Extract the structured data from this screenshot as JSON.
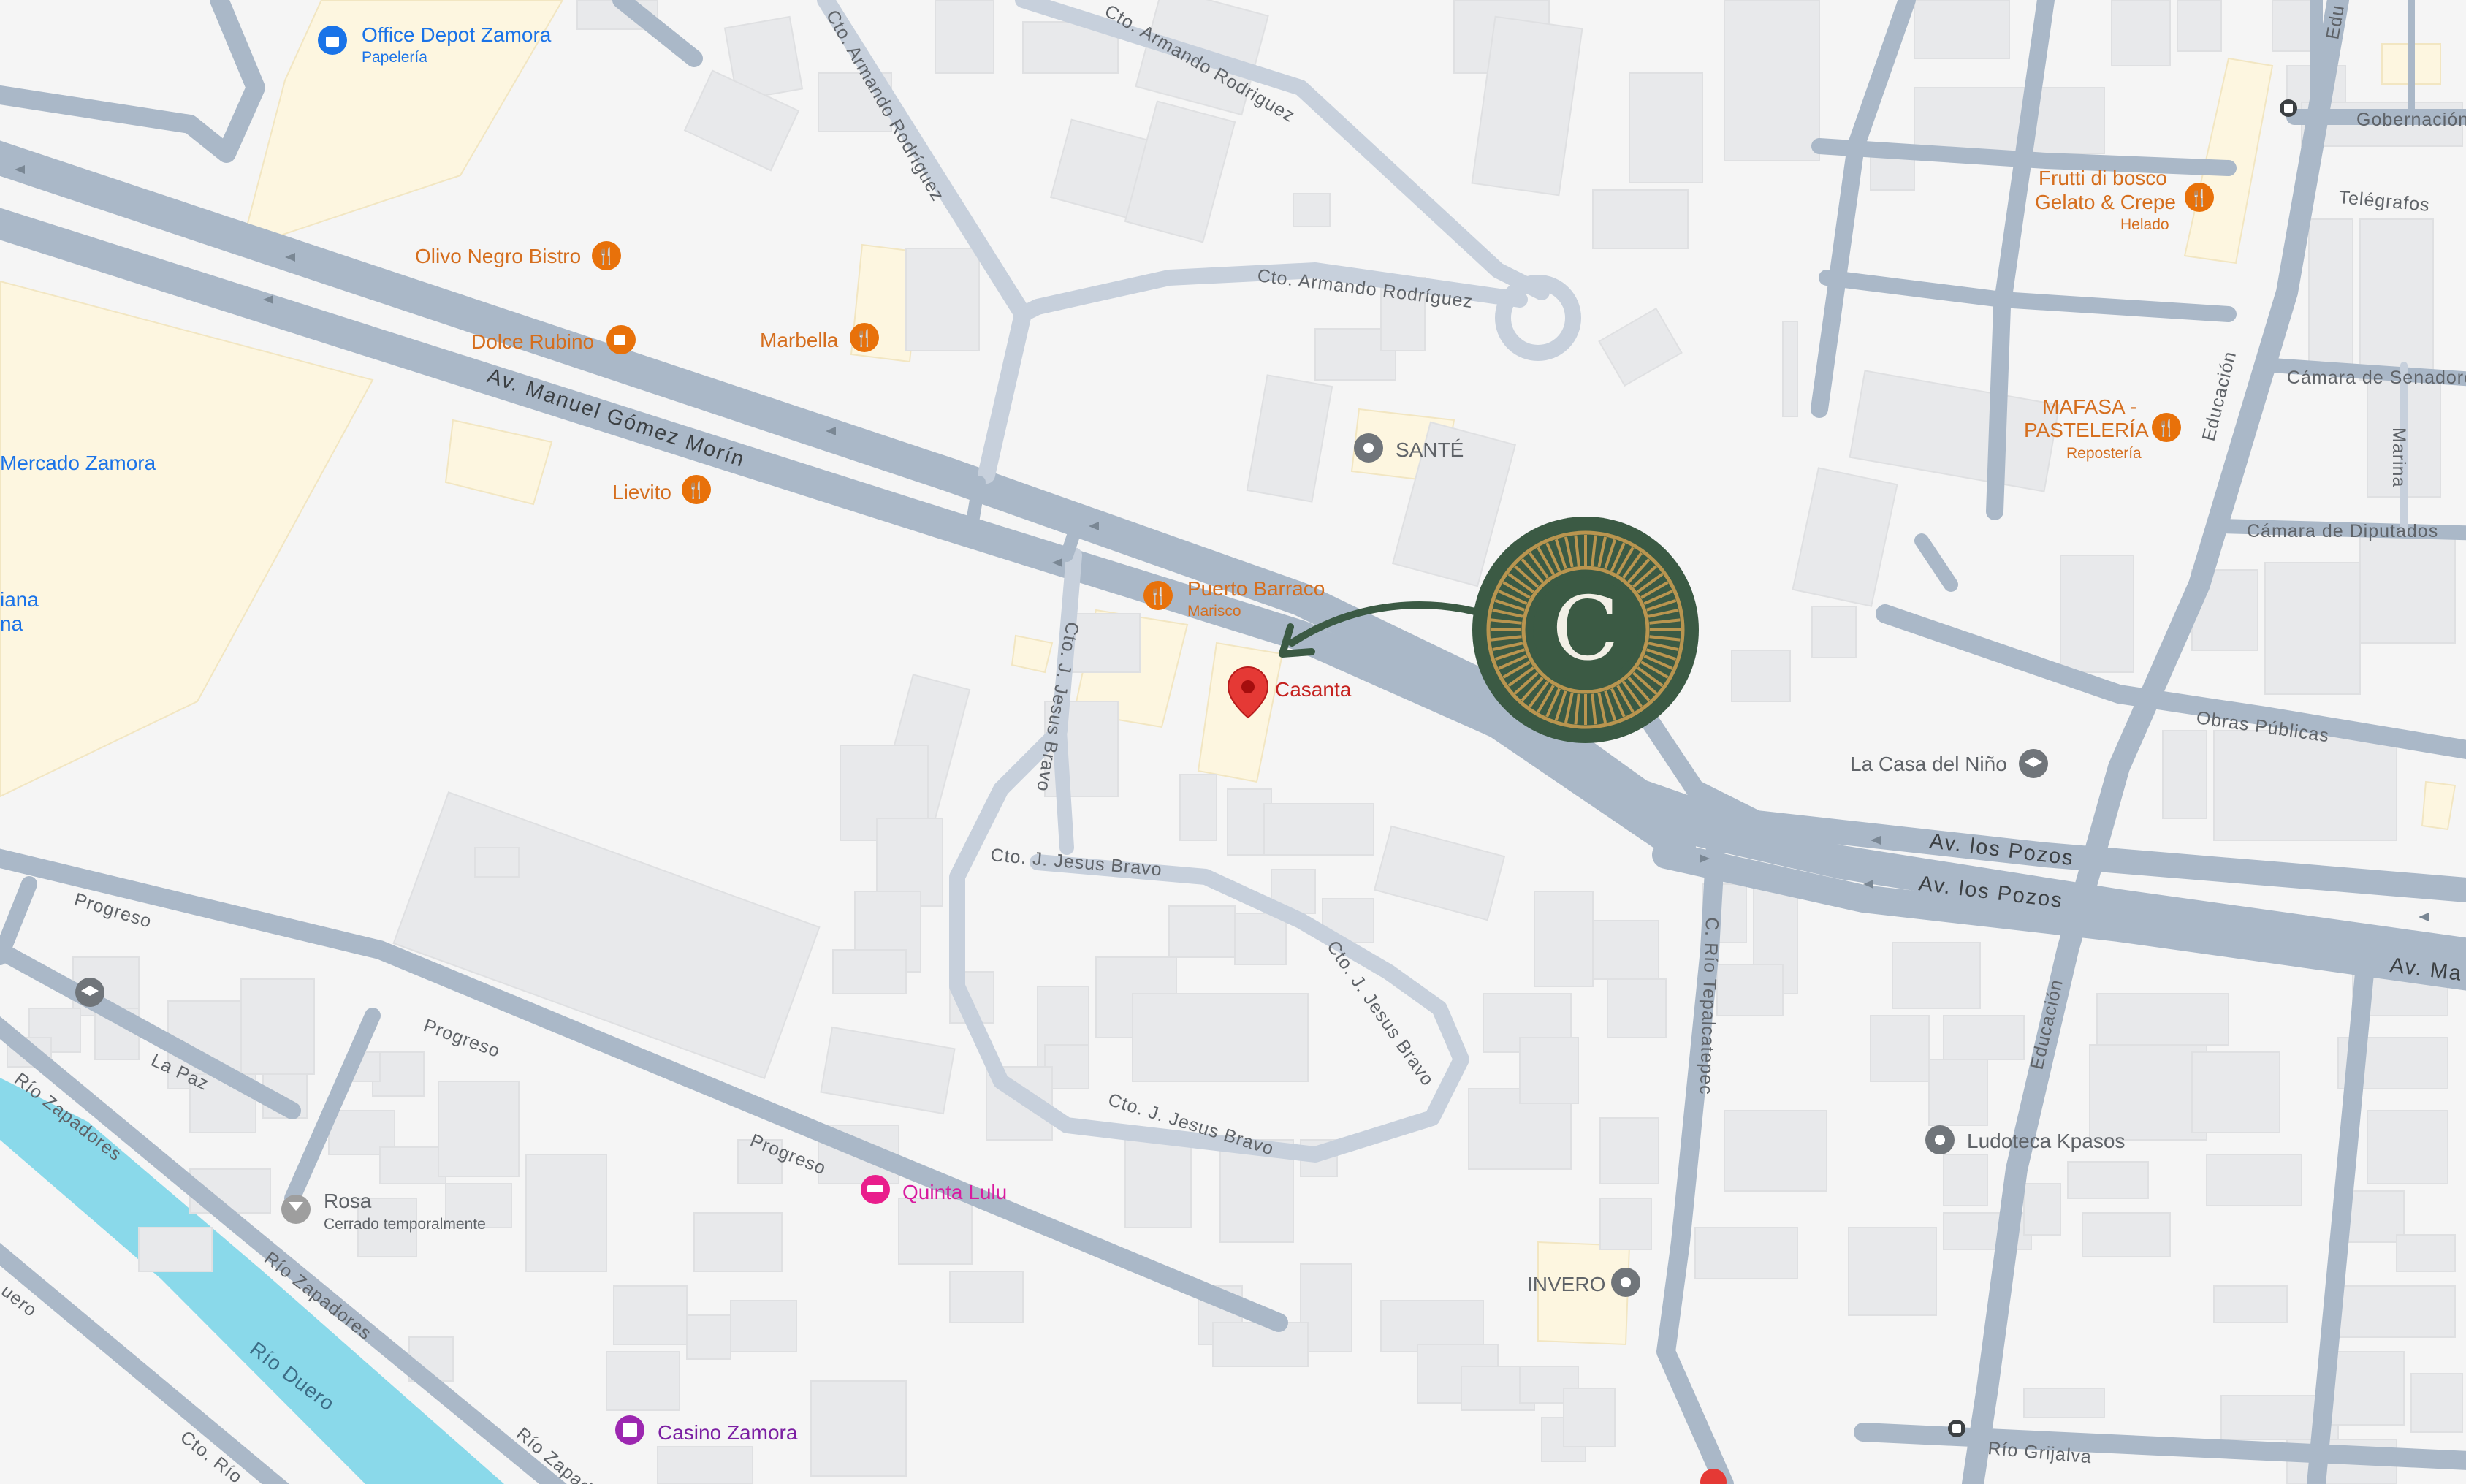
{
  "map": {
    "roads": {
      "av_manuel_gomez_morin": "Av. Manuel Gómez Morín",
      "av_los_pozos_1": "Av. los Pozos",
      "av_los_pozos_2": "Av. los Pozos",
      "av_ma_partial": "Av. Ma",
      "cto_armando_rodriguez_1": "Cto. Armando Rodríguez",
      "cto_armando_rodriguez_2": "Cto. Armando Rodríguez",
      "cto_armando_rodriguez_3": "Cto. Armando Rodriguez",
      "cto_j_jesus_bravo_1": "Cto. J. Jesus Bravo",
      "cto_j_jesus_bravo_2": "Cto. J. Jesus Bravo",
      "cto_j_jesus_bravo_3": "Cto. J. Jesus Bravo",
      "cto_j_jesus_bravo_4": "Cto. J. Jesus Bravo",
      "progreso_1": "Progreso",
      "progreso_2": "Progreso",
      "progreso_3": "Progreso",
      "la_paz": "La Paz",
      "rio_zapadores_1": "Río Zapadores",
      "rio_zapadores_2": "Río Zapadores",
      "rio_zapadores_3": "Río Zapadores",
      "c_rio_tepalcatepec": "C. Río Tepalcatepec",
      "educacion_1": "Educación",
      "educacion_2": "Educación",
      "educacion_3": "Edu",
      "obras_publicas": "Obras Públicas",
      "camara_de_senadores": "Cámara de Senadores",
      "camara_de_diputados": "Cámara de Diputados",
      "marina": "Marina",
      "telegrafos": "Telégrafos",
      "gobernacion": "Gobernación",
      "rio_grijalva": "Río Grijalva",
      "cto_rio": "Cto. Río",
      "uero": "uero"
    },
    "river": {
      "name": "Río Duero",
      "color": "#8ad9ea"
    },
    "pois": {
      "office_depot": {
        "name": "Office Depot Zamora",
        "sub": "Papelería",
        "icon": "shopping-bag-icon"
      },
      "olivo_negro": {
        "name": "Olivo Negro Bistro",
        "icon": "restaurant-icon"
      },
      "dolce_rubino": {
        "name": "Dolce Rubino",
        "icon": "cafe-icon"
      },
      "marbella": {
        "name": "Marbella",
        "icon": "restaurant-icon"
      },
      "mercado_zamora": {
        "name": "Mercado Zamora"
      },
      "iana": {
        "name": "iana"
      },
      "na": {
        "name": "na"
      },
      "lievito": {
        "name": "Lievito",
        "icon": "restaurant-icon"
      },
      "puerto_barraco": {
        "name": "Puerto Barraco",
        "sub": "Marisco",
        "icon": "restaurant-icon"
      },
      "casanta": {
        "name": "Casanta",
        "icon": "location-pin-icon"
      },
      "sante": {
        "name": "SANTÉ",
        "icon": "place-icon"
      },
      "frutti_di_bosco": {
        "name": "Frutti di bosco",
        "name2": "Gelato & Crepe",
        "sub": "Helado",
        "icon": "restaurant-icon"
      },
      "mafasa": {
        "name": "MAFASA -",
        "name2": "PASTELERÍA",
        "sub": "Repostería",
        "icon": "restaurant-icon"
      },
      "la_casa_del_nino": {
        "name": "La Casa del Niño",
        "icon": "school-icon"
      },
      "ludoteca": {
        "name": "Ludoteca Kpasos",
        "icon": "place-icon"
      },
      "invero": {
        "name": "INVERO",
        "icon": "place-icon"
      },
      "rosa": {
        "name": "Rosa",
        "sub": "Cerrado temporalmente",
        "icon": "bar-icon"
      },
      "quinta_lulu": {
        "name": "Quinta Lulu",
        "icon": "hotel-icon"
      },
      "casino_zamora": {
        "name": "Casino Zamora",
        "icon": "casino-icon"
      }
    },
    "logo": {
      "letter": "C",
      "color": "#3b5a44",
      "accent": "#b9954f"
    },
    "colors": {
      "road": "#aab8c8",
      "building": "#e8e9eb",
      "highlight": "#fdf6e0",
      "poi_orange": "#d56e1e",
      "poi_blue": "#1a73e8",
      "pin_red": "#e53935"
    }
  }
}
